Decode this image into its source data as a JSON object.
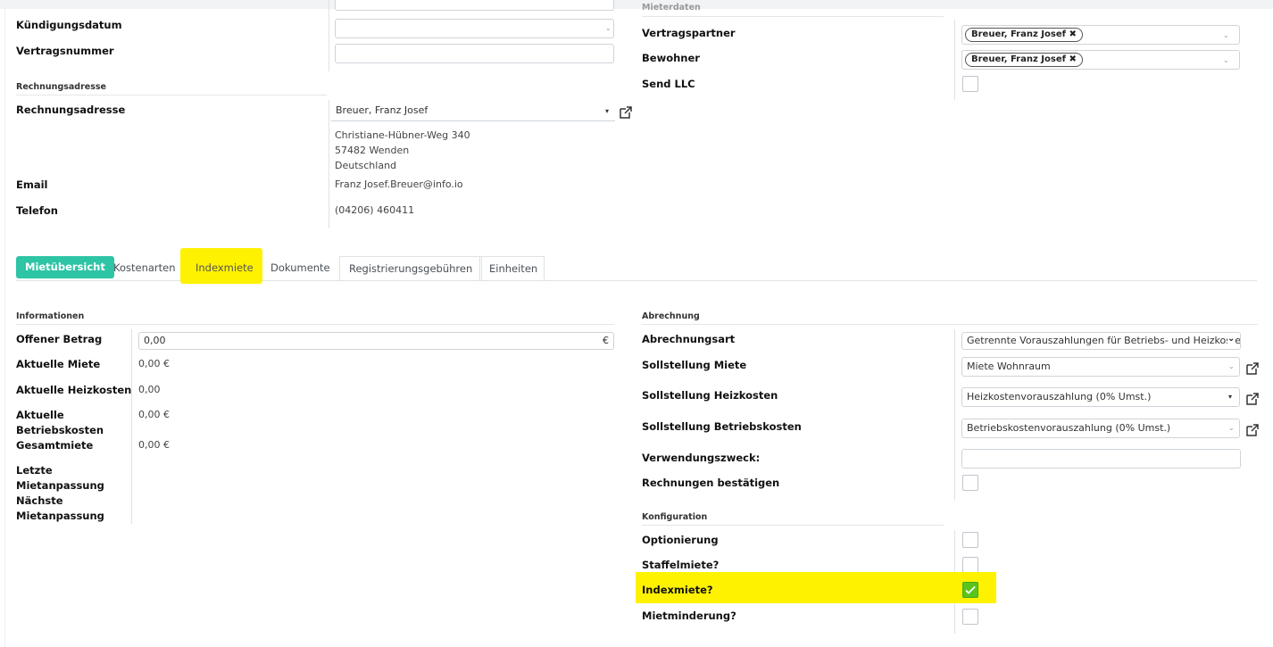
{
  "top": {
    "kuendigungsdatum_label": "Kündigungsdatum",
    "vertragsnummer_label": "Vertragsnummer",
    "mieterdaten_section": "Mieterdaten",
    "vertragspartner_label": "Vertragspartner",
    "vertragspartner_tag": "Breuer, Franz Josef",
    "bewohner_label": "Bewohner",
    "bewohner_tag": "Breuer, Franz Josef",
    "send_llc_label": "Send LLC"
  },
  "rechnung": {
    "section": "Rechnungsadresse",
    "label": "Rechnungsadresse",
    "value": "Breuer, Franz Josef",
    "street": "Christiane-Hübner-Weg 340",
    "city": "57482 Wenden",
    "country": "Deutschland",
    "email_label": "Email",
    "email_value": "Franz Josef.Breuer@info.io",
    "telefon_label": "Telefon",
    "telefon_value": "(04206) 460411"
  },
  "tabs": [
    "Mietübersicht",
    "Kostenarten",
    "Indexmiete",
    "Dokumente",
    "Registrierungsgebühren",
    "Einheiten"
  ],
  "informationen": {
    "section": "Informationen",
    "offener_betrag_label": "Offener Betrag",
    "offener_betrag_value": "0,00",
    "currency": "€",
    "aktuelle_miete_label": "Aktuelle Miete",
    "aktuelle_miete_value": "0,00 €",
    "aktuelle_heizkosten_label": "Aktuelle Heizkosten",
    "aktuelle_heizkosten_value": "0,00",
    "aktuelle_betriebskosten_label1": "Aktuelle",
    "aktuelle_betriebskosten_label2": "Betriebskosten",
    "aktuelle_betriebskosten_value": "0,00 €",
    "gesamtmiete_label": "Gesamtmiete",
    "gesamtmiete_value": "0,00 €",
    "letzte_label1": "Letzte",
    "letzte_label2": "Mietanpassung",
    "naechste_label1": "Nächste",
    "naechste_label2": "Mietanpassung"
  },
  "abrechnung": {
    "section": "Abrechnung",
    "abrechnungsart_label": "Abrechnungsart",
    "abrechnungsart_value": "Getrennte Vorauszahlungen für Betriebs- und Heizkosten",
    "sollstellung_miete_label": "Sollstellung Miete",
    "sollstellung_miete_value": "Miete Wohnraum",
    "sollstellung_heizkosten_label": "Sollstellung Heizkosten",
    "sollstellung_heizkosten_value": "Heizkostenvorauszahlung (0% Umst.)",
    "sollstellung_betriebskosten_label": "Sollstellung Betriebskosten",
    "sollstellung_betriebskosten_value": "Betriebskostenvorauszahlung (0% Umst.)",
    "verwendungszweck_label": "Verwendungszweck:",
    "rechnungen_label": "Rechnungen bestätigen"
  },
  "konfiguration": {
    "section": "Konfiguration",
    "optionierung_label": "Optionierung",
    "staffelmiete_label": "Staffelmiete?",
    "indexmiete_label": "Indexmiete?",
    "indexmiete_checked": true,
    "mietminderung_label": "Mietminderung?"
  },
  "colors": {
    "accent": "#2ec4a6",
    "highlight": "#fff200",
    "check_green": "#5ac41d"
  }
}
